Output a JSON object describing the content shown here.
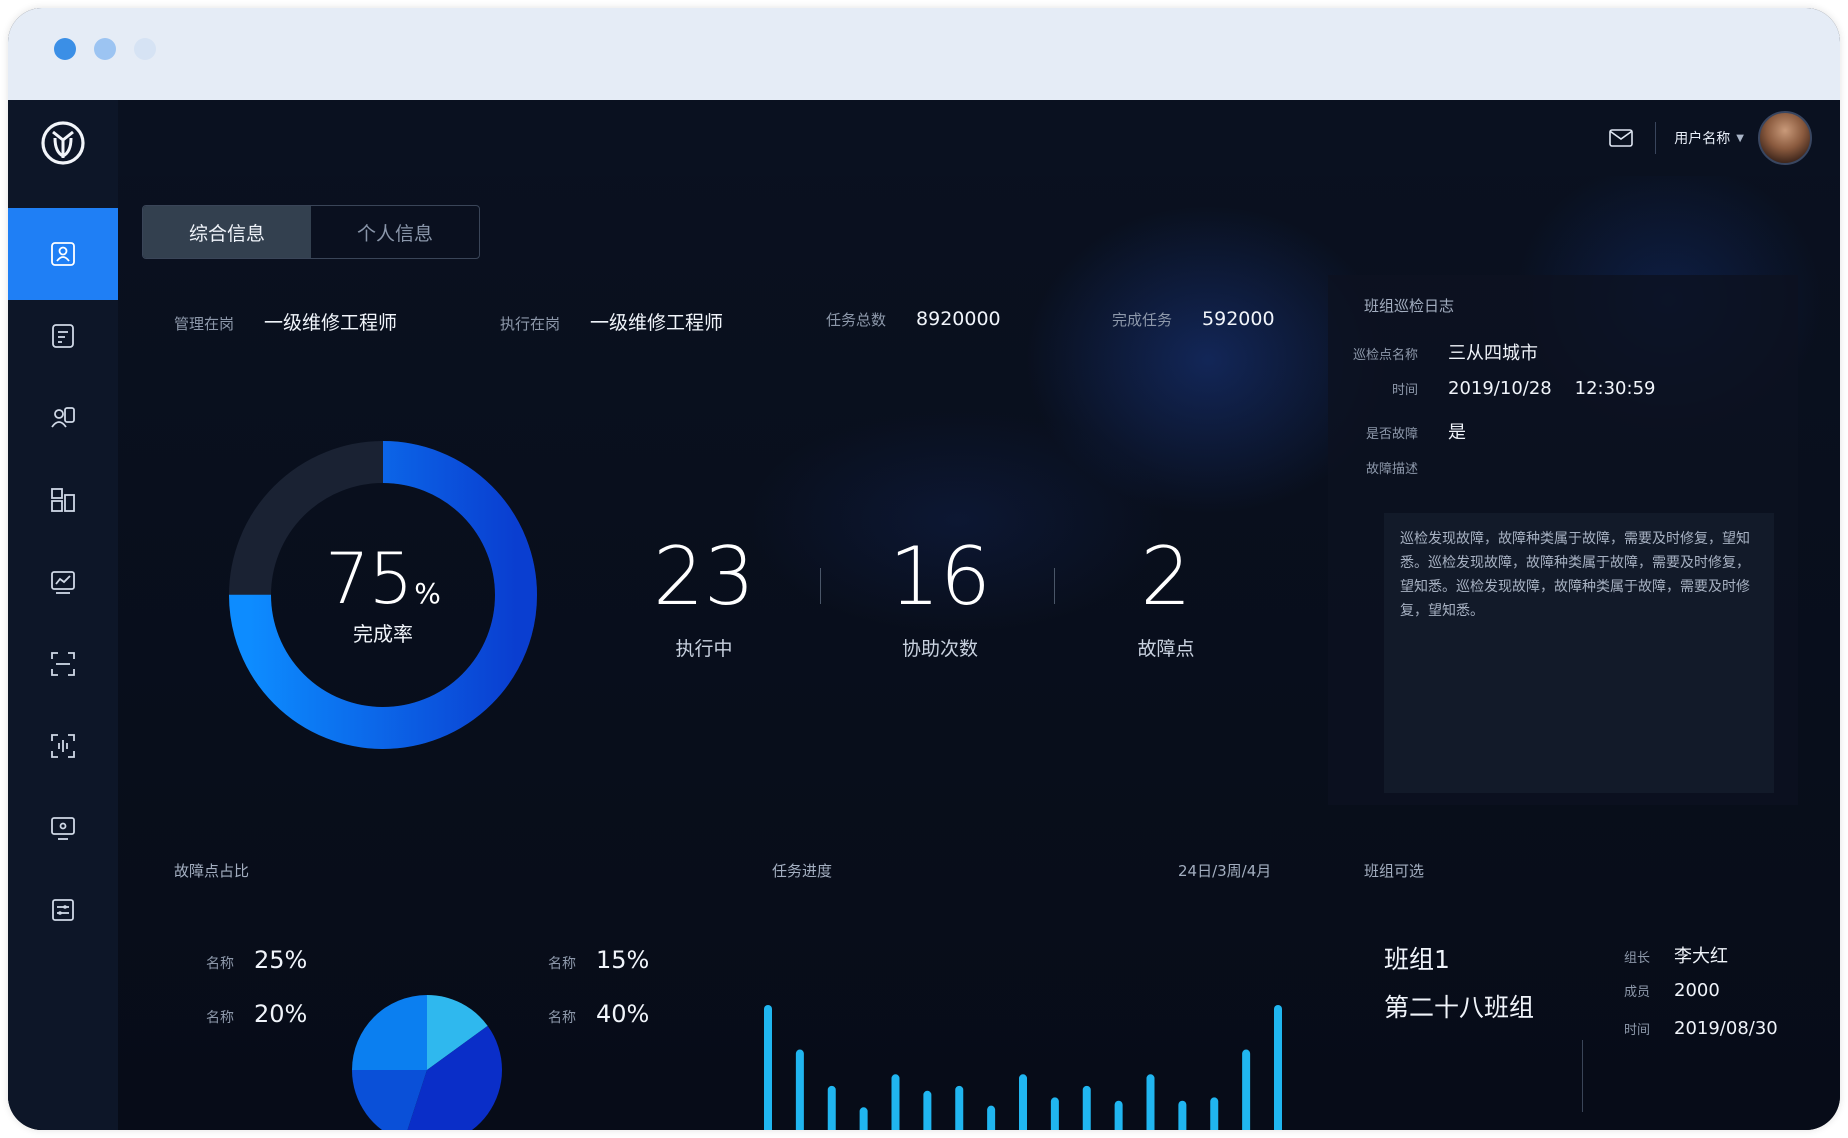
{
  "header": {
    "username": "用户名称"
  },
  "tabs": [
    {
      "label": "综合信息",
      "active": true
    },
    {
      "label": "个人信息",
      "active": false
    }
  ],
  "info": {
    "manager_post": {
      "key": "管理在岗",
      "value": "一级维修工程师"
    },
    "exec_post": {
      "key": "执行在岗",
      "value": "一级维修工程师"
    },
    "task_total": {
      "key": "任务总数",
      "value": "8920000"
    },
    "task_done": {
      "key": "完成任务",
      "value": "592000"
    }
  },
  "completion": {
    "percent": "75",
    "unit": "%",
    "label": "完成率",
    "fraction": 0.75
  },
  "stats": [
    {
      "value": "23",
      "label": "执行中"
    },
    {
      "value": "16",
      "label": "协助次数"
    },
    {
      "value": "2",
      "label": "故障点"
    }
  ],
  "log": {
    "title": "班组巡检日志",
    "rows": [
      {
        "key": "巡检点名称",
        "value": "三从四城市"
      },
      {
        "key": "时间",
        "value": "2019/10/28    12:30:59"
      },
      {
        "key": "是否故障",
        "value": "是"
      },
      {
        "key": "故障描述",
        "value": ""
      }
    ],
    "description": "巡检发现故障，故障种类属于故障，需要及时修复，望知悉。巡检发现故障，故障种类属于故障，需要及时修复，望知悉。巡检发现故障，故障种类属于故障，需要及时修复，望知悉。"
  },
  "fault_ratio": {
    "title": "故障点占比",
    "left": [
      {
        "key": "名称",
        "value": "25%"
      },
      {
        "key": "名称",
        "value": "20%"
      }
    ],
    "right": [
      {
        "key": "名称",
        "value": "15%"
      },
      {
        "key": "名称",
        "value": "40%"
      }
    ]
  },
  "task_progress": {
    "title": "任务进度",
    "range": "24日/3周/4月"
  },
  "team": {
    "title": "班组可选",
    "name1": "班组1",
    "name2": "第二十八班组",
    "fields": [
      {
        "key": "组长",
        "value": "李大红"
      },
      {
        "key": "成员",
        "value": "2000"
      },
      {
        "key": "时间",
        "value": "2019/08/30"
      }
    ]
  },
  "chart_data": [
    {
      "type": "pie",
      "slices": [
        {
          "value": 15,
          "color": "#2fb8ee"
        },
        {
          "value": 40,
          "color": "#0a2ec8"
        },
        {
          "value": 20,
          "color": "#0a50d8"
        },
        {
          "value": 25,
          "color": "#0b7ff0"
        }
      ]
    },
    {
      "type": "bar",
      "values": [
        100,
        73,
        51,
        38,
        58,
        48,
        51,
        39,
        58,
        44,
        51,
        42,
        58,
        42,
        44,
        73,
        100
      ],
      "ylim": [
        0,
        100
      ],
      "color": "#20b6f0"
    }
  ]
}
